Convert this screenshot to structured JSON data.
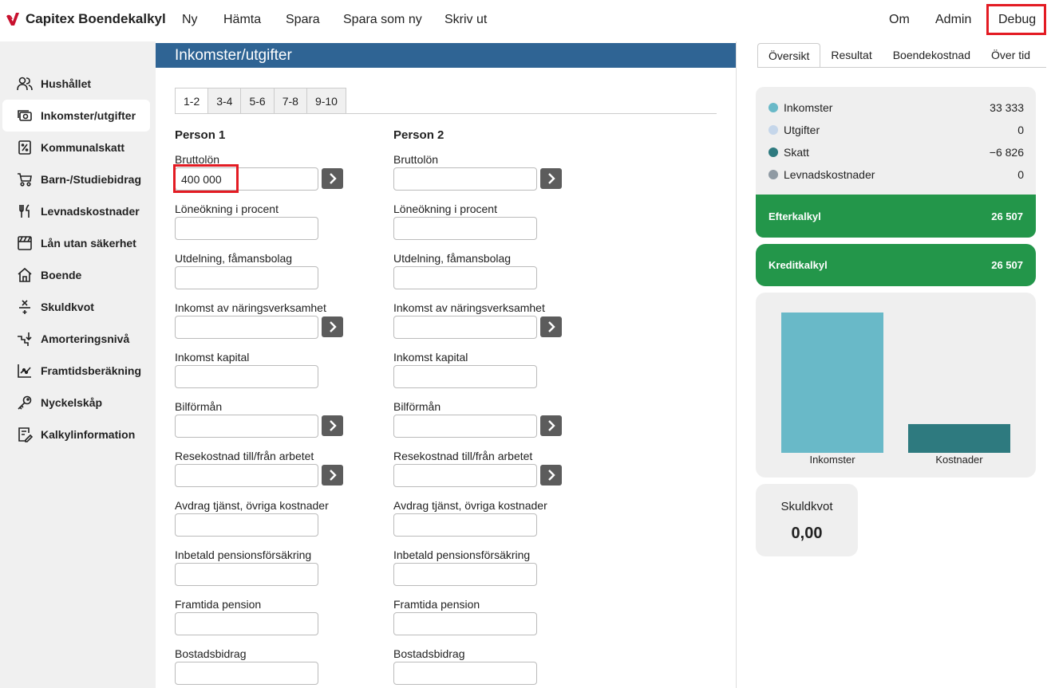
{
  "app": {
    "title": "Capitex Boendekalkyl"
  },
  "topnav": {
    "items": [
      "Ny",
      "Hämta",
      "Spara",
      "Spara som ny",
      "Skriv ut"
    ],
    "right": [
      "Om",
      "Admin",
      "Debug"
    ]
  },
  "sidebar": {
    "items": [
      {
        "label": "Hushållet",
        "icon": "users-icon"
      },
      {
        "label": "Inkomster/utgifter",
        "icon": "money-icon",
        "active": true
      },
      {
        "label": "Kommunalskatt",
        "icon": "percent-icon"
      },
      {
        "label": "Barn-/Studiebidrag",
        "icon": "stroller-icon"
      },
      {
        "label": "Levnadskostnader",
        "icon": "cutlery-icon"
      },
      {
        "label": "Lån utan säkerhet",
        "icon": "loan-icon"
      },
      {
        "label": "Boende",
        "icon": "house-icon"
      },
      {
        "label": "Skuldkvot",
        "icon": "division-icon"
      },
      {
        "label": "Amorteringsnivå",
        "icon": "stairs-icon"
      },
      {
        "label": "Framtidsberäkning",
        "icon": "growth-chart-icon"
      },
      {
        "label": "Nyckelskåp",
        "icon": "key-icon"
      },
      {
        "label": "Kalkylinformation",
        "icon": "edit-doc-icon"
      }
    ]
  },
  "main": {
    "title": "Inkomster/utgifter",
    "subtabs": [
      "1-2",
      "3-4",
      "5-6",
      "7-8",
      "9-10"
    ],
    "person1": {
      "title": "Person 1"
    },
    "person2": {
      "title": "Person 2"
    },
    "fields": [
      {
        "label": "Bruttolön",
        "has_arrow": true,
        "p1_value": "400 000",
        "p2_value": ""
      },
      {
        "label": "Löneökning i procent",
        "has_arrow": false,
        "p1_value": "",
        "p2_value": ""
      },
      {
        "label": "Utdelning, fåmansbolag",
        "has_arrow": false,
        "p1_value": "",
        "p2_value": ""
      },
      {
        "label": "Inkomst av näringsverksamhet",
        "has_arrow": true,
        "p1_value": "",
        "p2_value": ""
      },
      {
        "label": "Inkomst kapital",
        "has_arrow": false,
        "p1_value": "",
        "p2_value": ""
      },
      {
        "label": "Bilförmån",
        "has_arrow": true,
        "p1_value": "",
        "p2_value": ""
      },
      {
        "label": "Resekostnad till/från arbetet",
        "has_arrow": true,
        "p1_value": "",
        "p2_value": ""
      },
      {
        "label": "Avdrag tjänst, övriga kostnader",
        "has_arrow": false,
        "p1_value": "",
        "p2_value": ""
      },
      {
        "label": "Inbetald pensionsförsäkring",
        "has_arrow": false,
        "p1_value": "",
        "p2_value": ""
      },
      {
        "label": "Framtida pension",
        "has_arrow": false,
        "p1_value": "",
        "p2_value": ""
      },
      {
        "label": "Bostadsbidrag",
        "has_arrow": false,
        "p1_value": "",
        "p2_value": ""
      }
    ]
  },
  "right": {
    "tabs": [
      "Översikt",
      "Resultat",
      "Boendekostnad",
      "Över tid"
    ],
    "summary": [
      {
        "label": "Inkomster",
        "value": "33 333",
        "color": "#69b9c8"
      },
      {
        "label": "Utgifter",
        "value": "0",
        "color": "#c5d6ea"
      },
      {
        "label": "Skatt",
        "value": "−6 826",
        "color": "#2e7a7f"
      },
      {
        "label": "Levnadskostnader",
        "value": "0",
        "color": "#8f9aa3"
      }
    ],
    "efterkalkyl": {
      "label": "Efterkalkyl",
      "value": "26 507"
    },
    "kreditkalkyl": {
      "label": "Kreditkalkyl",
      "value": "26 507"
    },
    "skuldkvot": {
      "label": "Skuldkvot",
      "value": "0,00"
    }
  },
  "chart_data": {
    "type": "bar",
    "categories": [
      "Inkomster",
      "Kostnader"
    ],
    "values": [
      33333,
      6826
    ],
    "colors": [
      "#69b9c8",
      "#2e7a7f"
    ],
    "title": "",
    "xlabel": "",
    "ylabel": "",
    "ylim": [
      0,
      33333
    ],
    "grid": false
  }
}
